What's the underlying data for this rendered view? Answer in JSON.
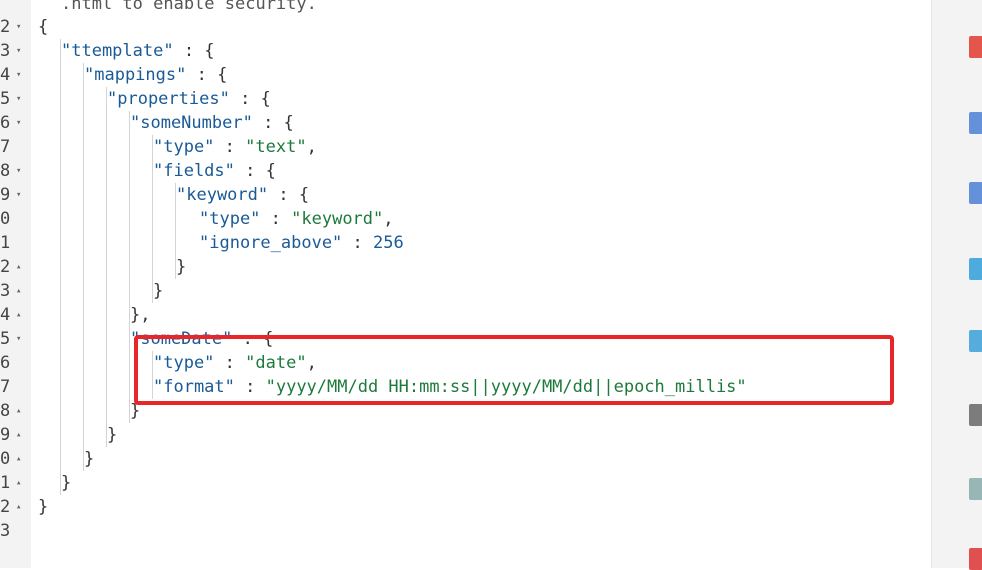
{
  "editor": {
    "lines": [
      {
        "num": "2",
        "fold": "▾",
        "text": "{",
        "indent": 0,
        "parts": [
          {
            "t": "punc",
            "v": "{"
          }
        ]
      },
      {
        "num": "3",
        "fold": "▾",
        "indent": 1,
        "parts": [
          {
            "t": "key",
            "v": "\"ttemplate\""
          },
          {
            "t": "punc",
            "v": " : {"
          }
        ]
      },
      {
        "num": "4",
        "fold": "▾",
        "indent": 2,
        "parts": [
          {
            "t": "key",
            "v": "\"mappings\""
          },
          {
            "t": "punc",
            "v": " : {"
          }
        ]
      },
      {
        "num": "5",
        "fold": "▾",
        "indent": 3,
        "parts": [
          {
            "t": "key",
            "v": "\"properties\""
          },
          {
            "t": "punc",
            "v": " : {"
          }
        ]
      },
      {
        "num": "6",
        "fold": "▾",
        "indent": 4,
        "parts": [
          {
            "t": "key",
            "v": "\"someNumber\""
          },
          {
            "t": "punc",
            "v": " : {"
          }
        ]
      },
      {
        "num": "7",
        "fold": "",
        "indent": 5,
        "parts": [
          {
            "t": "key",
            "v": "\"type\""
          },
          {
            "t": "punc",
            "v": " : "
          },
          {
            "t": "str",
            "v": "\"text\""
          },
          {
            "t": "punc",
            "v": ","
          }
        ]
      },
      {
        "num": "8",
        "fold": "▾",
        "indent": 5,
        "parts": [
          {
            "t": "key",
            "v": "\"fields\""
          },
          {
            "t": "punc",
            "v": " : {"
          }
        ]
      },
      {
        "num": "9",
        "fold": "▾",
        "indent": 6,
        "parts": [
          {
            "t": "key",
            "v": "\"keyword\""
          },
          {
            "t": "punc",
            "v": " : {"
          }
        ]
      },
      {
        "num": "0",
        "fold": "",
        "indent": 7,
        "parts": [
          {
            "t": "key",
            "v": "\"type\""
          },
          {
            "t": "punc",
            "v": " : "
          },
          {
            "t": "str",
            "v": "\"keyword\""
          },
          {
            "t": "punc",
            "v": ","
          }
        ]
      },
      {
        "num": "1",
        "fold": "",
        "indent": 7,
        "parts": [
          {
            "t": "key",
            "v": "\"ignore_above\""
          },
          {
            "t": "punc",
            "v": " : "
          },
          {
            "t": "num",
            "v": "256"
          }
        ]
      },
      {
        "num": "2",
        "fold": "▴",
        "indent": 6,
        "parts": [
          {
            "t": "punc",
            "v": "}"
          }
        ]
      },
      {
        "num": "3",
        "fold": "▴",
        "indent": 5,
        "parts": [
          {
            "t": "punc",
            "v": "}"
          }
        ]
      },
      {
        "num": "4",
        "fold": "▴",
        "indent": 4,
        "parts": [
          {
            "t": "punc",
            "v": "},"
          }
        ]
      },
      {
        "num": "5",
        "fold": "▾",
        "indent": 4,
        "parts": [
          {
            "t": "key",
            "v": "\"someDate\""
          },
          {
            "t": "punc",
            "v": " : {"
          }
        ]
      },
      {
        "num": "6",
        "fold": "",
        "indent": 5,
        "parts": [
          {
            "t": "key",
            "v": "\"type\""
          },
          {
            "t": "punc",
            "v": " : "
          },
          {
            "t": "str",
            "v": "\"date\""
          },
          {
            "t": "punc",
            "v": ","
          }
        ]
      },
      {
        "num": "7",
        "fold": "",
        "indent": 5,
        "parts": [
          {
            "t": "key",
            "v": "\"format\""
          },
          {
            "t": "punc",
            "v": " : "
          },
          {
            "t": "str",
            "v": "\"yyyy/MM/dd HH:mm:ss||yyyy/MM/dd||epoch_millis\""
          }
        ]
      },
      {
        "num": "8",
        "fold": "▴",
        "indent": 4,
        "parts": [
          {
            "t": "punc",
            "v": "}"
          }
        ]
      },
      {
        "num": "9",
        "fold": "▴",
        "indent": 3,
        "parts": [
          {
            "t": "punc",
            "v": "}"
          }
        ]
      },
      {
        "num": "0",
        "fold": "▴",
        "indent": 2,
        "parts": [
          {
            "t": "punc",
            "v": "}"
          }
        ]
      },
      {
        "num": "1",
        "fold": "▴",
        "indent": 1,
        "parts": [
          {
            "t": "punc",
            "v": "}"
          }
        ]
      },
      {
        "num": "2",
        "fold": "▴",
        "indent": 0,
        "parts": [
          {
            "t": "punc",
            "v": "}"
          }
        ]
      },
      {
        "num": "3",
        "fold": "",
        "indent": 0,
        "parts": []
      }
    ],
    "header_partial": ".html to enable security."
  },
  "colors": {
    "key": "#1a5a96",
    "string": "#1e7a3c",
    "highlight": "#e8262a"
  },
  "dock_icons": [
    "app-icon-red",
    "word-doc-icon",
    "word-doc-icon",
    "archive-icon",
    "archive-icon",
    "drive-icon",
    "disk-icon",
    "pdf-icon"
  ]
}
